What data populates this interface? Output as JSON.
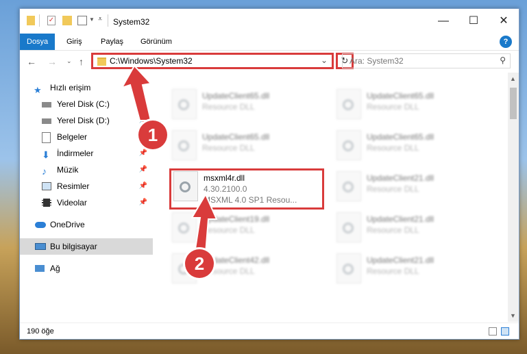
{
  "window": {
    "title": "System32",
    "controls": {
      "minimize": "—",
      "maximize": "☐",
      "close": "✕"
    }
  },
  "ribbon": {
    "tabs": [
      "Dosya",
      "Giriş",
      "Paylaş",
      "Görünüm"
    ],
    "help": "?"
  },
  "address": {
    "path": "C:\\Windows\\System32",
    "search_placeholder": "Ara: System32"
  },
  "sidebar": {
    "items": [
      {
        "label": "Hızlı erişim",
        "icon": "star-icon"
      },
      {
        "label": "Yerel Disk (C:)",
        "icon": "drive-icon"
      },
      {
        "label": "Yerel Disk (D:)",
        "icon": "drive-icon"
      },
      {
        "label": "Belgeler",
        "icon": "document-icon"
      },
      {
        "label": "İndirmeler",
        "icon": "download-icon"
      },
      {
        "label": "Müzik",
        "icon": "music-icon"
      },
      {
        "label": "Resimler",
        "icon": "pictures-icon"
      },
      {
        "label": "Videolar",
        "icon": "video-icon"
      },
      {
        "label": "OneDrive",
        "icon": "cloud-icon"
      },
      {
        "label": "Bu bilgisayar",
        "icon": "computer-icon"
      },
      {
        "label": "Ağ",
        "icon": "network-icon"
      }
    ]
  },
  "files": [
    {
      "name": "UpdateClient65.dll",
      "line2": "Resource DLL"
    },
    {
      "name": "UpdateClient65.dll",
      "line2": "Resource DLL"
    },
    {
      "name": "UpdateClient65.dll",
      "line2": "Resource DLL"
    },
    {
      "name": "UpdateClient65.dll",
      "line2": "Resource DLL"
    },
    {
      "name": "msxml4r.dll",
      "line2": "4.30.2100.0",
      "line3": "MSXML 4.0 SP1 Resou..."
    },
    {
      "name": "UpdateClient21.dll",
      "line2": "Resource DLL"
    },
    {
      "name": "UpdateClient19.dll",
      "line2": "Resource DLL"
    },
    {
      "name": "UpdateClient21.dll",
      "line2": "Resource DLL"
    },
    {
      "name": "UpdateClient42.dll",
      "line2": "Resource DLL"
    },
    {
      "name": "UpdateClient21.dll",
      "line2": "Resource DLL"
    }
  ],
  "status": {
    "count": "190 öğe"
  },
  "annotations": {
    "step1": "1",
    "step2": "2"
  },
  "colors": {
    "highlight": "#d93b3b",
    "ribbon_active": "#1979ca"
  }
}
